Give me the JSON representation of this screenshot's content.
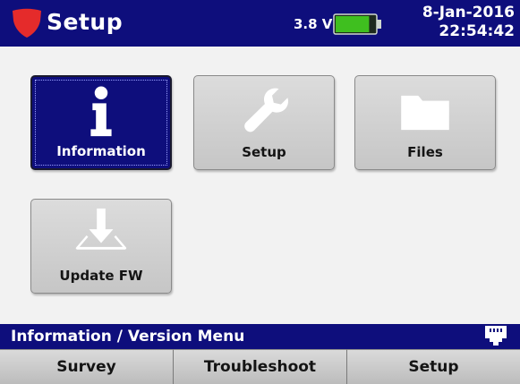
{
  "header": {
    "title": "Setup",
    "logo_icon": "shield-logo-icon",
    "voltage": "3.8 V",
    "battery_icon": "battery-icon",
    "battery_level": 0.85,
    "date": "8-Jan-2016",
    "time": "22:54:42"
  },
  "tiles": [
    {
      "label": "Information",
      "icon": "info-icon",
      "selected": true
    },
    {
      "label": "Setup",
      "icon": "wrench-icon",
      "selected": false
    },
    {
      "label": "Files",
      "icon": "folder-icon",
      "selected": false
    },
    {
      "label": "Update FW",
      "icon": "download-tray-icon",
      "selected": false
    }
  ],
  "status": {
    "text": "Information / Version Menu",
    "icon": "network-port-icon"
  },
  "tabs": [
    {
      "label": "Survey"
    },
    {
      "label": "Troubleshoot"
    },
    {
      "label": "Setup"
    }
  ],
  "colors": {
    "header_bg": "#0e0e7c",
    "logo_red": "#e52b2b",
    "battery_green": "#3fbf1f",
    "selected_tile": "#0e0e7c"
  }
}
